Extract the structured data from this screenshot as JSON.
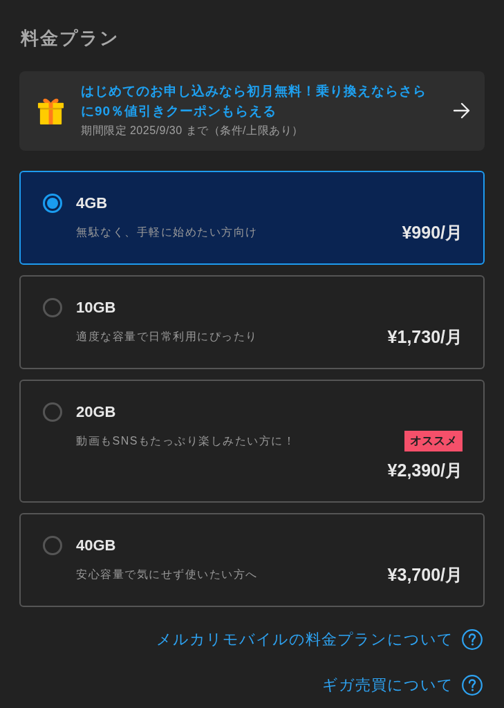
{
  "header": {
    "title": "料金プラン"
  },
  "promo": {
    "headline": "はじめてのお申し込みなら初月無料！乗り換えならさらに90％値引きクーポンもらえる",
    "note": "期間限定 2025/9/30 まで（条件/上限あり）"
  },
  "plans": [
    {
      "name": "4GB",
      "description": "無駄なく、手軽に始めたい方向け",
      "price": "¥990/月",
      "selected": true
    },
    {
      "name": "10GB",
      "description": "適度な容量で日常利用にぴったり",
      "price": "¥1,730/月",
      "selected": false
    },
    {
      "name": "20GB",
      "description": "動画もSNSもたっぷり楽しみたい方に！",
      "badge": "オススメ",
      "price": "¥2,390/月",
      "selected": false
    },
    {
      "name": "40GB",
      "description": "安心容量で気にせず使いたい方へ",
      "price": "¥3,700/月",
      "selected": false
    }
  ],
  "links": [
    {
      "label": "メルカリモバイルの料金プランについて"
    },
    {
      "label": "ギガ売買について"
    }
  ]
}
